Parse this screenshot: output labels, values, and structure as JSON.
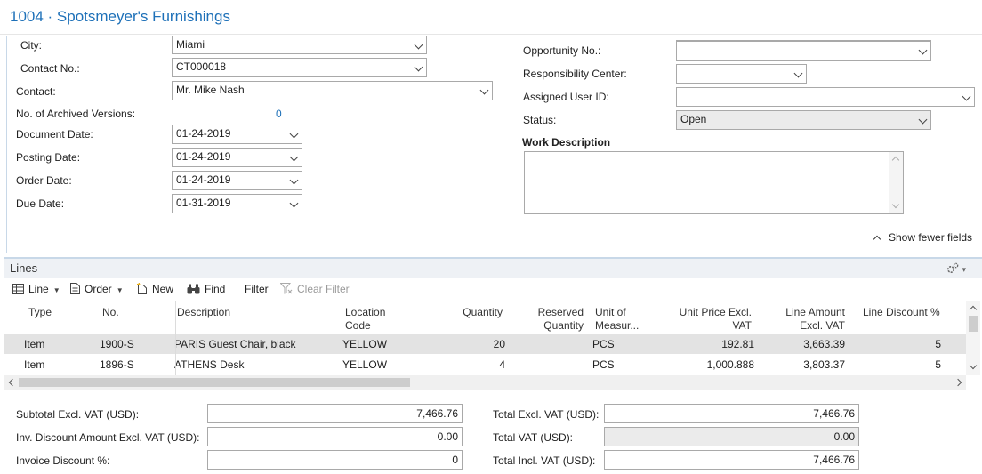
{
  "title": "1004 · Spotsmeyer's Furnishings",
  "left_fields": {
    "city": {
      "label": "City:",
      "value": "Miami"
    },
    "contact_no": {
      "label": "Contact No.:",
      "value": "CT000018"
    },
    "contact": {
      "label": "Contact:",
      "value": "Mr. Mike Nash"
    },
    "archived": {
      "label": "No. of Archived Versions:",
      "value": "0"
    },
    "document_date": {
      "label": "Document Date:",
      "value": "01-24-2019"
    },
    "posting_date": {
      "label": "Posting Date:",
      "value": "01-24-2019"
    },
    "order_date": {
      "label": "Order Date:",
      "value": "01-24-2019"
    },
    "due_date": {
      "label": "Due Date:",
      "value": "01-31-2019"
    }
  },
  "right_fields": {
    "opportunity_no": {
      "label": "Opportunity No.:",
      "value": ""
    },
    "responsibility_center": {
      "label": "Responsibility Center:",
      "value": ""
    },
    "assigned_user": {
      "label": "Assigned User ID:",
      "value": ""
    },
    "status": {
      "label": "Status:",
      "value": "Open"
    },
    "work_description": {
      "label": "Work Description",
      "value": ""
    }
  },
  "show_fewer_label": "Show fewer fields",
  "lines": {
    "title": "Lines",
    "toolbar": {
      "line": "Line",
      "order": "Order",
      "new": "New",
      "find": "Find",
      "filter": "Filter",
      "clear_filter": "Clear Filter"
    },
    "columns": {
      "type": "Type",
      "no": "No.",
      "description": "Description",
      "location_1": "Location",
      "location_2": "Code",
      "quantity": "Quantity",
      "reserved_1": "Reserved",
      "reserved_2": "Quantity",
      "unit_1": "Unit of",
      "unit_2": "Measur...",
      "price_1": "Unit Price Excl.",
      "price_2": "VAT",
      "amount_1": "Line Amount",
      "amount_2": "Excl. VAT",
      "discount": "Line Discount %"
    },
    "rows": [
      {
        "type": "Item",
        "no": "1900-S",
        "description": "PARIS Guest Chair, black",
        "location": "YELLOW",
        "quantity": "20",
        "unit": "PCS",
        "unit_price": "192.81",
        "line_amount": "3,663.39",
        "line_discount": "5"
      },
      {
        "type": "Item",
        "no": "1896-S",
        "description": "ATHENS Desk",
        "location": "YELLOW",
        "quantity": "4",
        "unit": "PCS",
        "unit_price": "1,000.888",
        "line_amount": "3,803.37",
        "line_discount": "5"
      }
    ]
  },
  "totals": {
    "subtotal": {
      "label": "Subtotal Excl. VAT (USD):",
      "value": "7,466.76"
    },
    "inv_discount": {
      "label": "Inv. Discount Amount Excl. VAT (USD):",
      "value": "0.00"
    },
    "invoice_discount_pct": {
      "label": "Invoice Discount %:",
      "value": "0"
    },
    "total_excl": {
      "label": "Total Excl. VAT (USD):",
      "value": "7,466.76"
    },
    "total_vat": {
      "label": "Total VAT (USD):",
      "value": "0.00"
    },
    "total_incl": {
      "label": "Total Incl. VAT (USD):",
      "value": "7,466.76"
    }
  },
  "icons": {
    "line": "grid-icon",
    "order": "document-icon",
    "new": "new-document-icon",
    "find": "binoculars-icon",
    "clear_filter": "funnel-x-icon",
    "settings": "gear-icon"
  },
  "colors": {
    "accent": "#1d70b8",
    "selected_row": "#e3e3e3",
    "disabled_field": "#ebebeb"
  }
}
